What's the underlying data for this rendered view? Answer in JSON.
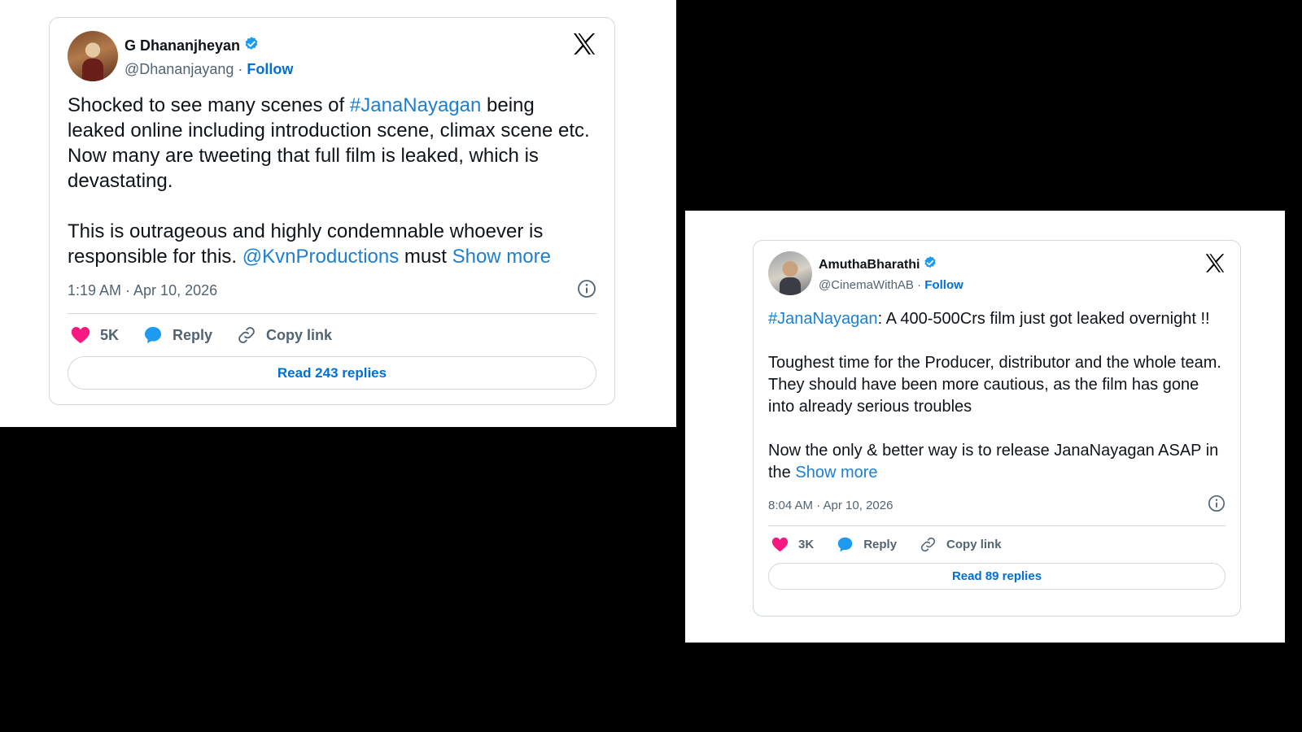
{
  "tweets": [
    {
      "author_name": "G Dhananjheyan",
      "handle": "@Dhananjayang",
      "separator": "·",
      "follow_label": "Follow",
      "paragraph1": {
        "before": "Shocked to see many scenes of ",
        "hashtag": "#JanaNayagan",
        "after": " being leaked online including introduction scene, climax scene etc. Now many are tweeting that full film is leaked, which is devastating."
      },
      "paragraph2": {
        "before": "This is outrageous and highly condemnable whoever is responsible for this. ",
        "mention": "@KvnProductions",
        "after": " must ",
        "show_more": "Show more"
      },
      "timestamp": "1:19 AM · Apr 10, 2026",
      "likes": "5K",
      "reply_label": "Reply",
      "copy_link_label": "Copy link",
      "read_replies_label": "Read 243 replies"
    },
    {
      "author_name": "AmuthaBharathi",
      "handle": "@CinemaWithAB",
      "separator": "·",
      "follow_label": "Follow",
      "paragraph1": {
        "hashtag": "#JanaNayagan",
        "after": ": A 400-500Crs film just got leaked overnight !!"
      },
      "paragraph2": "Toughest time for the Producer, distributor and the whole team. They should have been more cautious, as the film has gone into already serious troubles",
      "paragraph3": {
        "before": "Now the only & better way is to release JanaNayagan ASAP in the ",
        "show_more": "Show more"
      },
      "timestamp": "8:04 AM · Apr 10, 2026",
      "likes": "3K",
      "reply_label": "Reply",
      "copy_link_label": "Copy link",
      "read_replies_label": "Read 89 replies"
    }
  ],
  "colors": {
    "link": "#1d7fd1",
    "follow": "#006fd6",
    "heart": "#f91880",
    "reply_bubble": "#1d9bf0",
    "verified": "#1d9bf0",
    "muted_text": "#536471",
    "border": "#cfd9de",
    "background": "#000000"
  },
  "icons": [
    "verified-badge-icon",
    "x-logo-icon",
    "info-icon",
    "heart-icon",
    "reply-bubble-icon",
    "link-icon"
  ]
}
